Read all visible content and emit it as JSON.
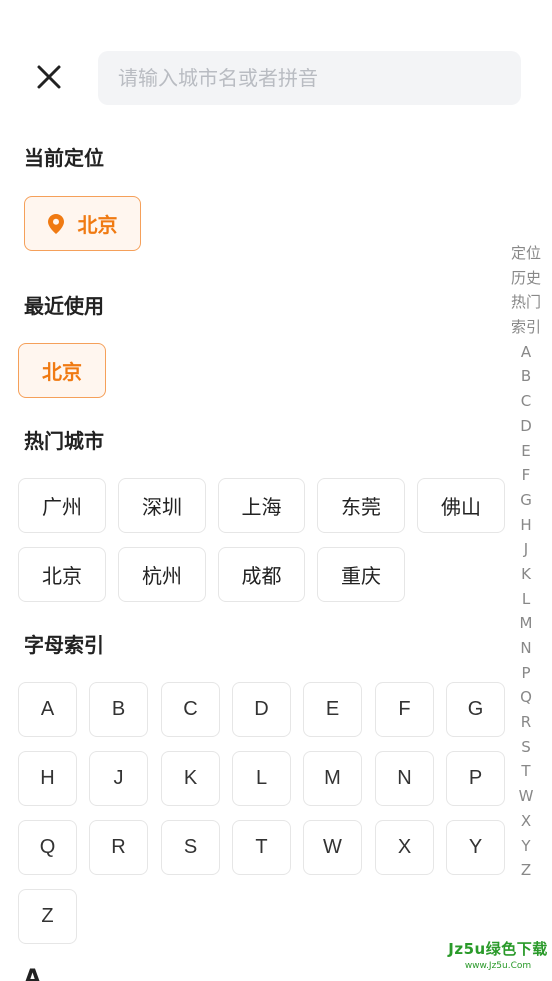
{
  "search": {
    "placeholder": "请输入城市名或者拼音"
  },
  "sections": {
    "current": "当前定位",
    "recent": "最近使用",
    "hot": "热门城市",
    "letters": "字母索引"
  },
  "current_city": "北京",
  "recent_cities": [
    "北京"
  ],
  "hot_cities": [
    "广州",
    "深圳",
    "上海",
    "东莞",
    "佛山",
    "北京",
    "杭州",
    "成都",
    "重庆"
  ],
  "letters": [
    "A",
    "B",
    "C",
    "D",
    "E",
    "F",
    "G",
    "H",
    "J",
    "K",
    "L",
    "M",
    "N",
    "P",
    "Q",
    "R",
    "S",
    "T",
    "W",
    "X",
    "Y",
    "Z"
  ],
  "side_index": [
    "定位",
    "历史",
    "热门",
    "索引",
    "A",
    "B",
    "C",
    "D",
    "E",
    "F",
    "G",
    "H",
    "J",
    "K",
    "L",
    "M",
    "N",
    "P",
    "Q",
    "R",
    "S",
    "T",
    "W",
    "X",
    "Y",
    "Z"
  ],
  "next_header": "A",
  "watermark": {
    "line1": "Jz5u绿色下载",
    "line2": "www.Jz5u.Com"
  },
  "colors": {
    "accent": "#f07a12",
    "accent_bg": "#fff6ef",
    "accent_border": "#f5a05a"
  }
}
